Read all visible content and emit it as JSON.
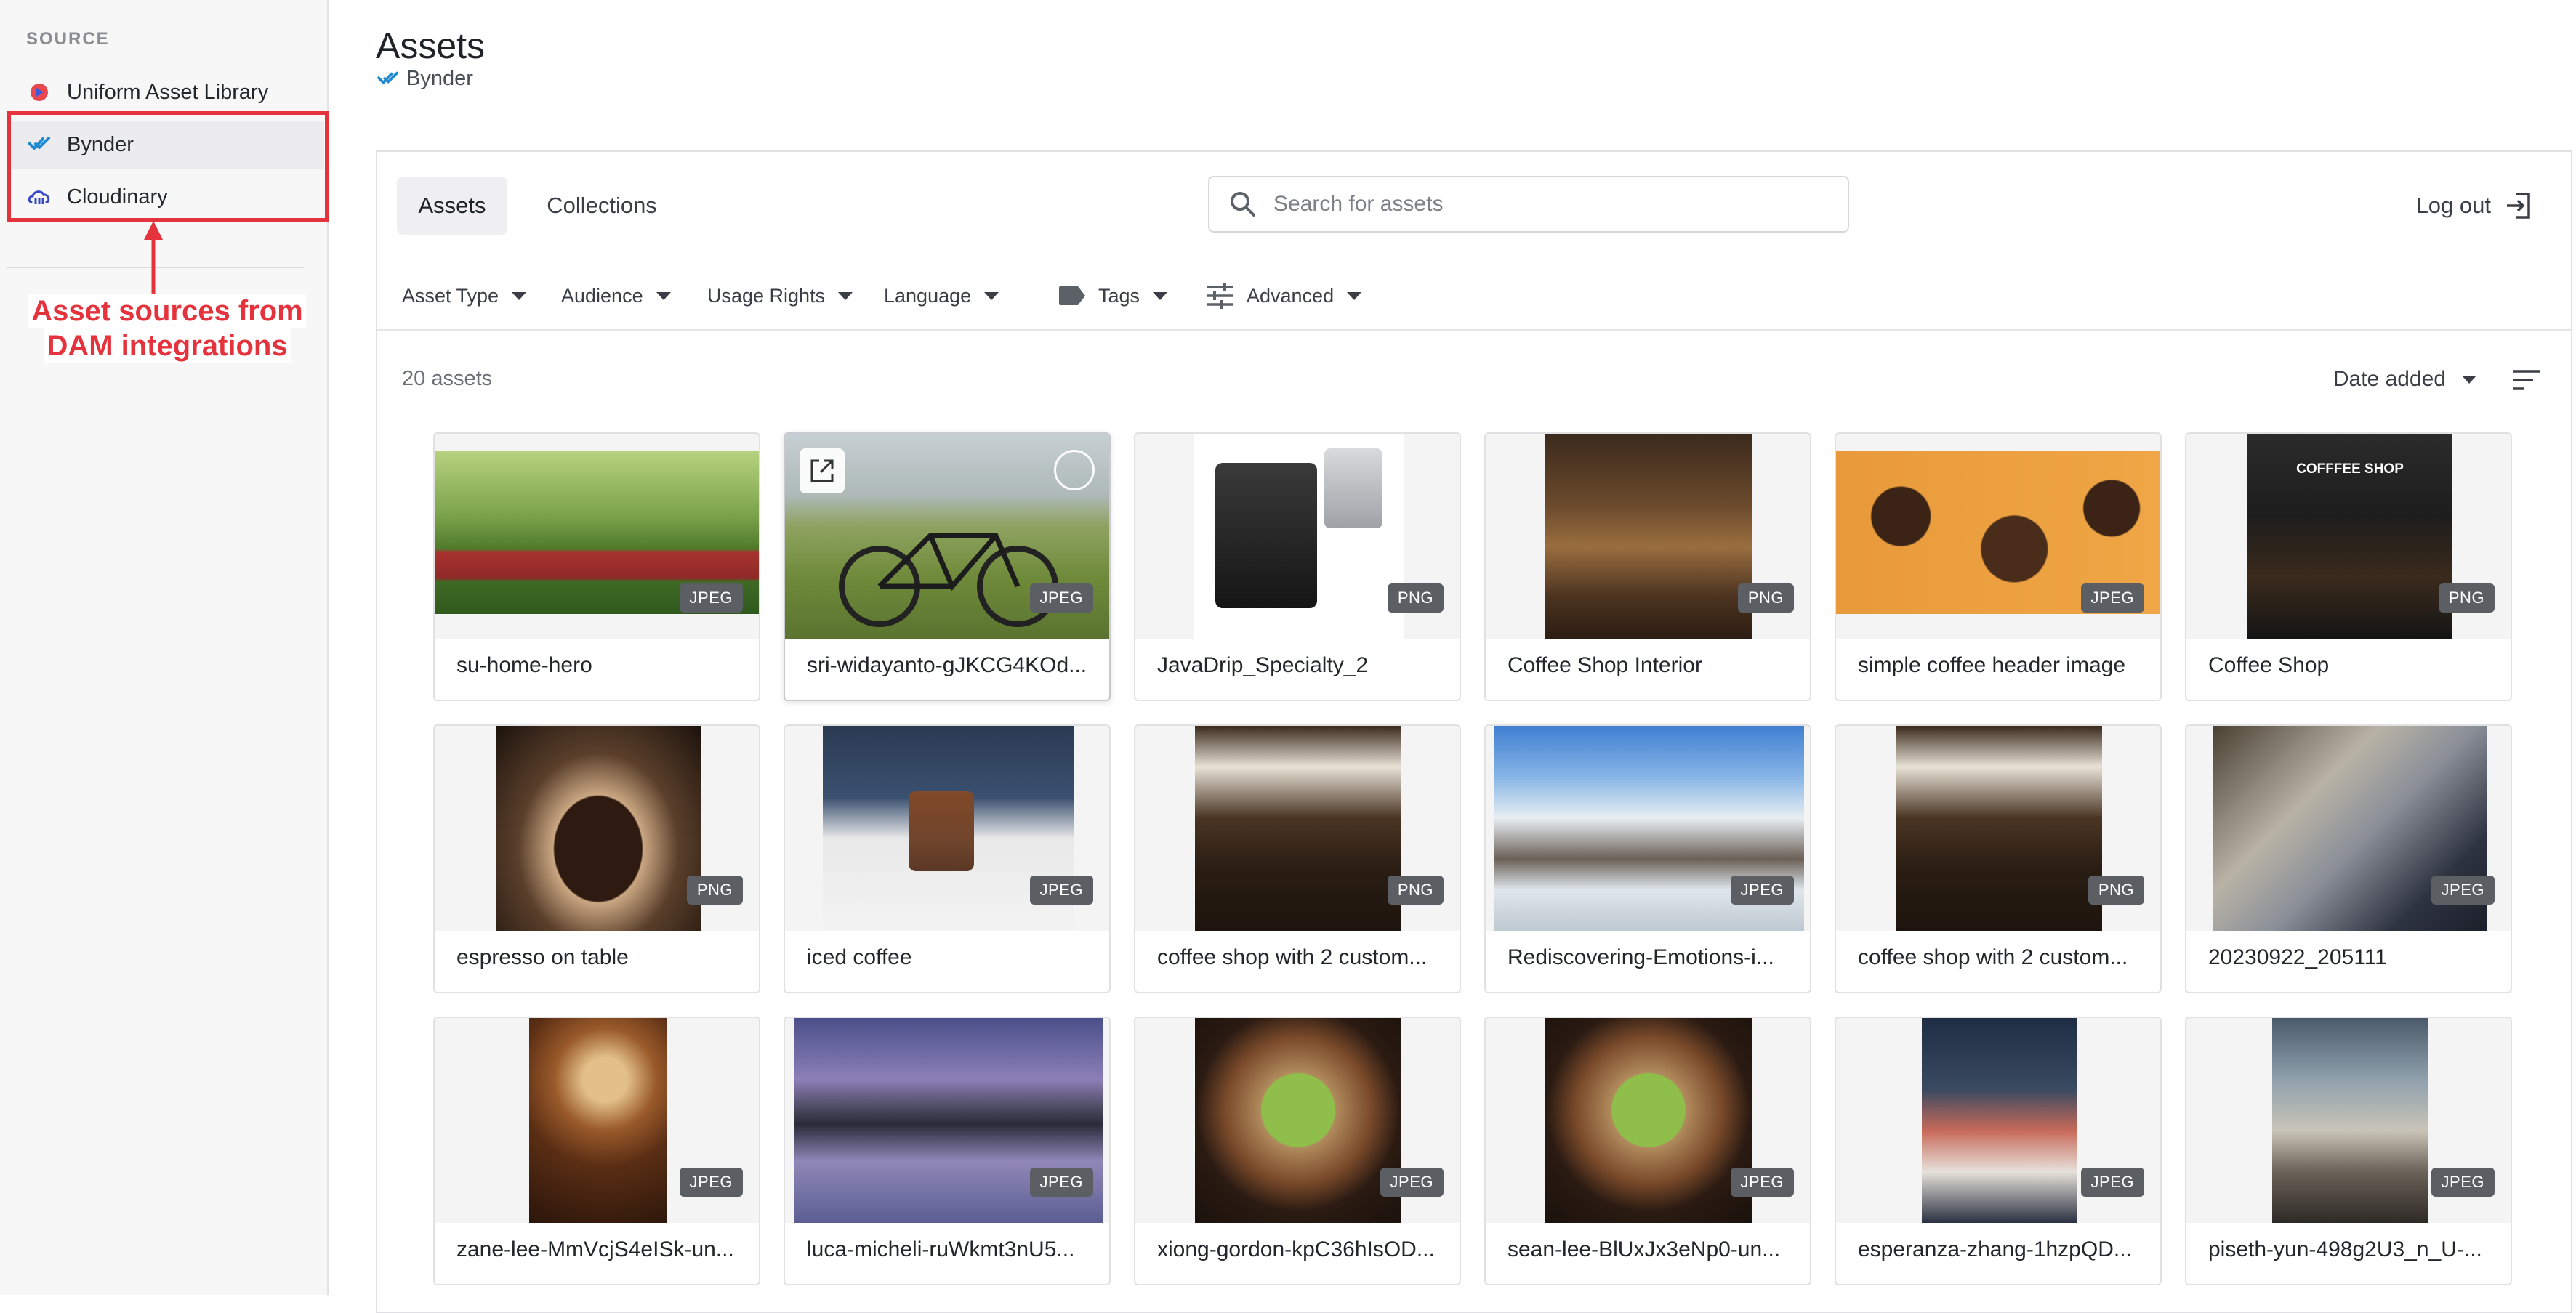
{
  "sidebar": {
    "heading": "SOURCE",
    "items": [
      {
        "label": "Uniform Asset Library",
        "icon": "uniform-logo-icon"
      },
      {
        "label": "Bynder",
        "icon": "bynder-logo-icon"
      },
      {
        "label": "Cloudinary",
        "icon": "cloudinary-logo-icon"
      }
    ],
    "active_index": 1
  },
  "annotation": {
    "line1": "Asset sources from",
    "line2": "DAM integrations",
    "color": "#e5333d"
  },
  "header": {
    "title": "Assets",
    "subtitle": "Bynder"
  },
  "tabs": [
    {
      "label": "Assets",
      "active": true
    },
    {
      "label": "Collections",
      "active": false
    }
  ],
  "search": {
    "placeholder": "Search for assets",
    "value": ""
  },
  "logout_label": "Log out",
  "filters": [
    {
      "label": "Asset Type",
      "icon": null
    },
    {
      "label": "Audience",
      "icon": null
    },
    {
      "label": "Usage Rights",
      "icon": null
    },
    {
      "label": "Language",
      "icon": null
    },
    {
      "label": "Tags",
      "icon": "tag-icon"
    },
    {
      "label": "Advanced",
      "icon": "sliders-icon"
    }
  ],
  "asset_count": "20 assets",
  "sort_label": "Date added",
  "assets": [
    {
      "title": "su-home-hero",
      "type": "JPEG"
    },
    {
      "title": "sri-widayanto-gJKCG4KOd...",
      "type": "JPEG"
    },
    {
      "title": "JavaDrip_Specialty_2",
      "type": "PNG"
    },
    {
      "title": "Coffee Shop Interior",
      "type": "PNG"
    },
    {
      "title": "simple coffee header image",
      "type": "JPEG"
    },
    {
      "title": "Coffee Shop",
      "type": "PNG",
      "thumb_text": "COFFFEE SHOP"
    },
    {
      "title": "espresso on table",
      "type": "PNG"
    },
    {
      "title": "iced coffee",
      "type": "JPEG"
    },
    {
      "title": "coffee shop with 2 custom...",
      "type": "PNG"
    },
    {
      "title": "Rediscovering-Emotions-i...",
      "type": "JPEG"
    },
    {
      "title": "coffee shop with 2 custom...",
      "type": "PNG"
    },
    {
      "title": "20230922_205111",
      "type": "JPEG"
    },
    {
      "title": "zane-lee-MmVcjS4eISk-un...",
      "type": "JPEG"
    },
    {
      "title": "luca-micheli-ruWkmt3nU5...",
      "type": "JPEG"
    },
    {
      "title": "xiong-gordon-kpC36hIsOD...",
      "type": "JPEG"
    },
    {
      "title": "sean-lee-BlUxJx3eNp0-un...",
      "type": "JPEG"
    },
    {
      "title": "esperanza-zhang-1hzpQD...",
      "type": "JPEG"
    },
    {
      "title": "piseth-yun-498g2U3_n_U-...",
      "type": "JPEG"
    }
  ],
  "colors": {
    "accent_red": "#e5333d",
    "badge_bg": "#5b5e63",
    "sidebar_bg": "#f7f7f8",
    "bynder_blue": "#1f8ad2"
  }
}
